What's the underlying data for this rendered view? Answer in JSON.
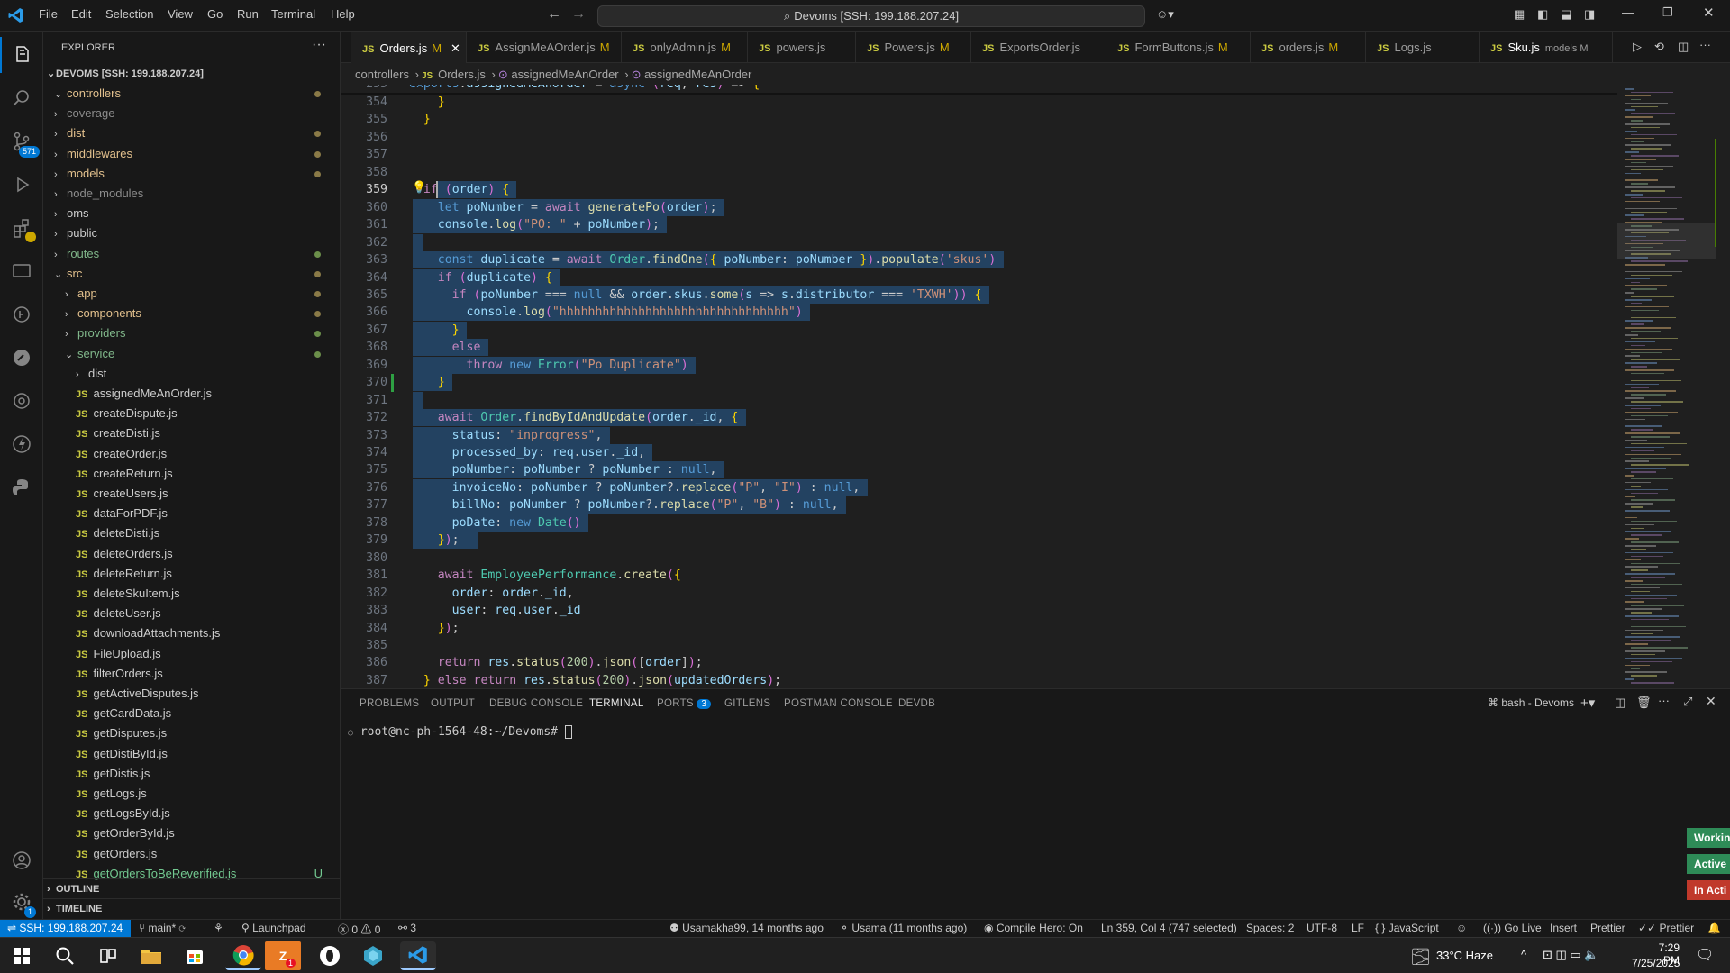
{
  "titlebar": {
    "menu": [
      "File",
      "Edit",
      "Selection",
      "View",
      "Go",
      "Run",
      "Terminal",
      "Help"
    ],
    "search": "Devoms [SSH: 199.188.207.24]"
  },
  "activity": {
    "scm_badge": "571",
    "settings_badge": "1"
  },
  "explorer": {
    "header": "EXPLORER",
    "root": "DEVOMS [SSH: 199.188.207.24]",
    "items": [
      {
        "label": "controllers",
        "indent": 1,
        "type": "folder-open",
        "dot": "y"
      },
      {
        "label": "coverage",
        "indent": 1,
        "type": "folder",
        "dim": true
      },
      {
        "label": "dist",
        "indent": 1,
        "type": "folder",
        "dot": "y"
      },
      {
        "label": "middlewares",
        "indent": 1,
        "type": "folder",
        "dot": "y"
      },
      {
        "label": "models",
        "indent": 1,
        "type": "folder",
        "dot": "y"
      },
      {
        "label": "node_modules",
        "indent": 1,
        "type": "folder",
        "dim": true
      },
      {
        "label": "oms",
        "indent": 1,
        "type": "folder"
      },
      {
        "label": "public",
        "indent": 1,
        "type": "folder"
      },
      {
        "label": "routes",
        "indent": 1,
        "type": "folder",
        "dot": "g"
      },
      {
        "label": "src",
        "indent": 1,
        "type": "folder-open",
        "dot": "y"
      },
      {
        "label": "app",
        "indent": 2,
        "type": "folder",
        "dot": "y"
      },
      {
        "label": "components",
        "indent": 2,
        "type": "folder",
        "dot": "y"
      },
      {
        "label": "providers",
        "indent": 2,
        "type": "folder",
        "dot": "g"
      },
      {
        "label": "service",
        "indent": 2,
        "type": "folder-open",
        "dot": "g"
      },
      {
        "label": "dist",
        "indent": 3,
        "type": "folder"
      },
      {
        "label": "assignedMeAnOrder.js",
        "indent": 3,
        "type": "js"
      },
      {
        "label": "createDispute.js",
        "indent": 3,
        "type": "js"
      },
      {
        "label": "createDisti.js",
        "indent": 3,
        "type": "js"
      },
      {
        "label": "createOrder.js",
        "indent": 3,
        "type": "js"
      },
      {
        "label": "createReturn.js",
        "indent": 3,
        "type": "js"
      },
      {
        "label": "createUsers.js",
        "indent": 3,
        "type": "js"
      },
      {
        "label": "dataForPDF.js",
        "indent": 3,
        "type": "js"
      },
      {
        "label": "deleteDisti.js",
        "indent": 3,
        "type": "js"
      },
      {
        "label": "deleteOrders.js",
        "indent": 3,
        "type": "js"
      },
      {
        "label": "deleteReturn.js",
        "indent": 3,
        "type": "js"
      },
      {
        "label": "deleteSkuItem.js",
        "indent": 3,
        "type": "js"
      },
      {
        "label": "deleteUser.js",
        "indent": 3,
        "type": "js"
      },
      {
        "label": "downloadAttachments.js",
        "indent": 3,
        "type": "js"
      },
      {
        "label": "FileUpload.js",
        "indent": 3,
        "type": "js"
      },
      {
        "label": "filterOrders.js",
        "indent": 3,
        "type": "js"
      },
      {
        "label": "getActiveDisputes.js",
        "indent": 3,
        "type": "js"
      },
      {
        "label": "getCardData.js",
        "indent": 3,
        "type": "js"
      },
      {
        "label": "getDisputes.js",
        "indent": 3,
        "type": "js"
      },
      {
        "label": "getDistiById.js",
        "indent": 3,
        "type": "js"
      },
      {
        "label": "getDistis.js",
        "indent": 3,
        "type": "js"
      },
      {
        "label": "getLogs.js",
        "indent": 3,
        "type": "js"
      },
      {
        "label": "getLogsById.js",
        "indent": 3,
        "type": "js"
      },
      {
        "label": "getOrderById.js",
        "indent": 3,
        "type": "js"
      },
      {
        "label": "getOrders.js",
        "indent": 3,
        "type": "js"
      },
      {
        "label": "getOrdersToBeReverified.js",
        "indent": 3,
        "type": "js",
        "untracked": "U"
      }
    ],
    "outline": "OUTLINE",
    "timeline": "TIMELINE"
  },
  "tabs": [
    {
      "label": "Orders.js",
      "mod": "M",
      "active": true
    },
    {
      "label": "AssignMeAOrder.js",
      "mod": "M"
    },
    {
      "label": "onlyAdmin.js",
      "mod": "M"
    },
    {
      "label": "powers.js",
      "mod": ""
    },
    {
      "label": "Powers.js",
      "mod": "M"
    },
    {
      "label": "ExportsOrder.js",
      "mod": ""
    },
    {
      "label": "FormButtons.js",
      "mod": "M"
    },
    {
      "label": "orders.js",
      "mod": "M"
    },
    {
      "label": "Logs.js",
      "mod": ""
    },
    {
      "label": "Sku.js",
      "mod": "models M"
    }
  ],
  "breadcrumb": [
    "controllers",
    "Orders.js",
    "assignedMeAnOrder",
    "assignedMeAnOrder"
  ],
  "sticky": {
    "ln": "255",
    "code": "exports.assignedMeAnOrder = async (req, res) => {"
  },
  "lines": [
    {
      "ln": "354",
      "code": "    }"
    },
    {
      "ln": "355",
      "code": "  }"
    },
    {
      "ln": "356",
      "code": ""
    },
    {
      "ln": "357",
      "code": ""
    },
    {
      "ln": "358",
      "code": ""
    },
    {
      "ln": "359",
      "code": "  if (order) {"
    },
    {
      "ln": "360",
      "code": "    let poNumber = await generatePo(order);"
    },
    {
      "ln": "361",
      "code": "    console.log(\"PO: \" + poNumber);"
    },
    {
      "ln": "362",
      "code": ""
    },
    {
      "ln": "363",
      "code": "    const duplicate = await Order.findOne({ poNumber: poNumber }).populate('skus')"
    },
    {
      "ln": "364",
      "code": "    if (duplicate) {"
    },
    {
      "ln": "365",
      "code": "      if (poNumber === null && order.skus.some(s => s.distributor === 'TXWH')) {"
    },
    {
      "ln": "366",
      "code": "        console.log(\"hhhhhhhhhhhhhhhhhhhhhhhhhhhhhhhh\")"
    },
    {
      "ln": "367",
      "code": "      }"
    },
    {
      "ln": "368",
      "code": "      else"
    },
    {
      "ln": "369",
      "code": "        throw new Error(\"Po Duplicate\")"
    },
    {
      "ln": "370",
      "code": "    }"
    },
    {
      "ln": "371",
      "code": ""
    },
    {
      "ln": "372",
      "code": "    await Order.findByIdAndUpdate(order._id, {"
    },
    {
      "ln": "373",
      "code": "      status: \"inprogress\","
    },
    {
      "ln": "374",
      "code": "      processed_by: req.user._id,"
    },
    {
      "ln": "375",
      "code": "      poNumber: poNumber ? poNumber : null,"
    },
    {
      "ln": "376",
      "code": "      invoiceNo: poNumber ? poNumber?.replace(\"P\", \"I\") : null,"
    },
    {
      "ln": "377",
      "code": "      billNo: poNumber ? poNumber?.replace(\"P\", \"B\") : null,"
    },
    {
      "ln": "378",
      "code": "      poDate: new Date()"
    },
    {
      "ln": "379",
      "code": "    });"
    },
    {
      "ln": "380",
      "code": ""
    },
    {
      "ln": "381",
      "code": "    await EmployeePerformance.create({"
    },
    {
      "ln": "382",
      "code": "      order: order._id,"
    },
    {
      "ln": "383",
      "code": "      user: req.user._id"
    },
    {
      "ln": "384",
      "code": "    });"
    },
    {
      "ln": "385",
      "code": ""
    },
    {
      "ln": "386",
      "code": "    return res.status(200).json([order]);"
    },
    {
      "ln": "387",
      "code": "  } else return res.status(200).json(updatedOrders);"
    }
  ],
  "panel": {
    "tabs": [
      "PROBLEMS",
      "OUTPUT",
      "DEBUG CONSOLE",
      "TERMINAL",
      "PORTS",
      "GITLENS",
      "POSTMAN CONSOLE",
      "DEVDB"
    ],
    "ports_badge": "3",
    "shell": "bash - Devoms",
    "prompt": "root@nc-ph-1564-48:~/Devoms#"
  },
  "right_tabs": [
    "Workin",
    "Active",
    "In Acti"
  ],
  "status": {
    "remote": "SSH: 199.188.207.24",
    "branch": "main*",
    "launchpad": "Launchpad",
    "errors": "0",
    "warnings": "0",
    "ports": "3",
    "blame": "Usamakha99, 14 months ago",
    "author": "Usama (11 months ago)",
    "compile": "Compile Hero: On",
    "position": "Ln 359, Col 4 (747 selected)",
    "spaces": "Spaces: 2",
    "encoding": "UTF-8",
    "eol": "LF",
    "language": "JavaScript",
    "golive": "Go Live",
    "insert": "Insert",
    "prettier1": "Prettier",
    "prettier2": "Prettier"
  },
  "taskbar": {
    "weather": "33°C  Haze",
    "time": "7:29 PM",
    "date": "7/25/2025",
    "zoom_badge": "1"
  },
  "colors": {
    "accent": "#0078d4",
    "selection": "#264f78"
  }
}
